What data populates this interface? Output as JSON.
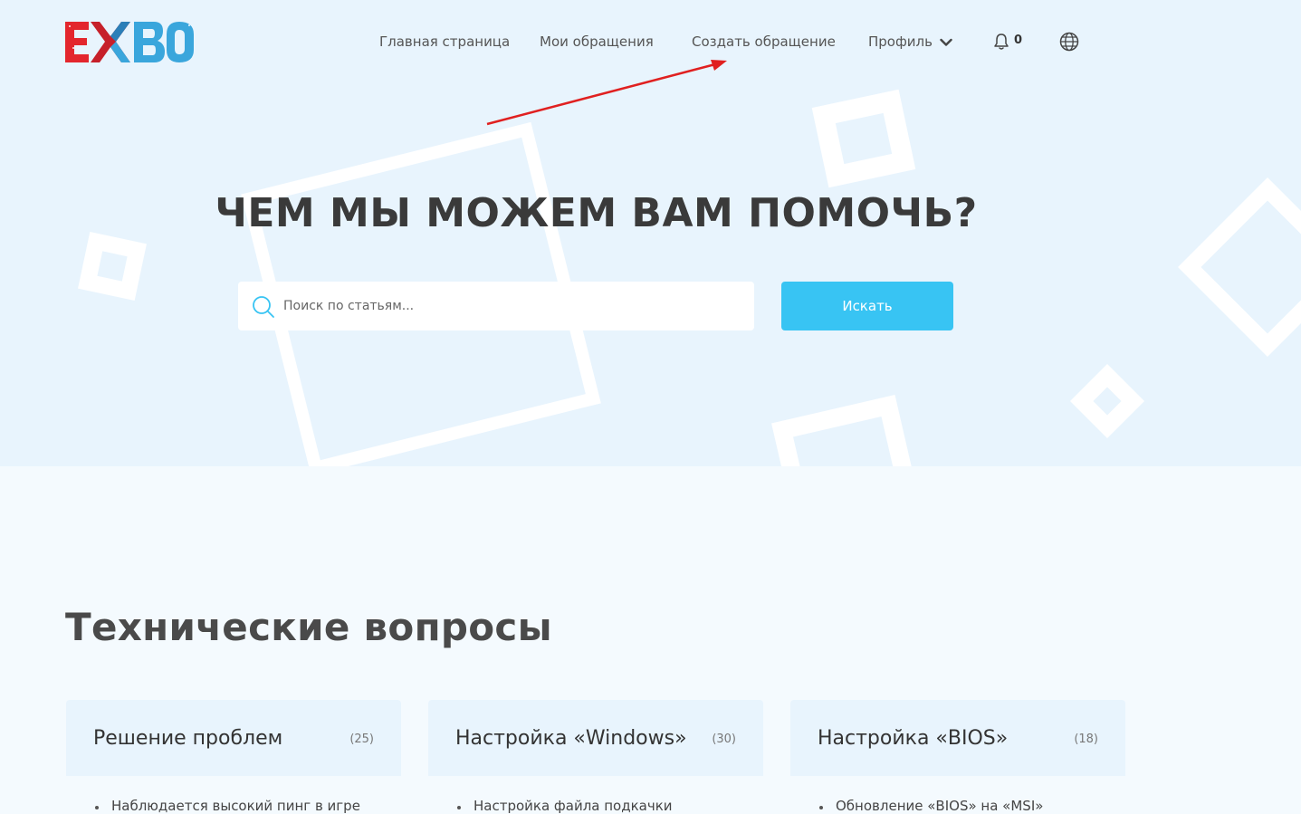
{
  "logo": {
    "text": "EXBO"
  },
  "nav": {
    "items": [
      {
        "label": "Главная страница"
      },
      {
        "label": "Мои обращения"
      },
      {
        "label": "Создать обращение"
      },
      {
        "label": "Профиль"
      }
    ],
    "notifications_count": "0"
  },
  "hero": {
    "title": "ЧЕМ МЫ МОЖЕМ ВАМ ПОМОЧЬ?",
    "search_placeholder": "Поиск по статьям...",
    "search_button": "Искать"
  },
  "section": {
    "title": "Технические вопросы",
    "cards": [
      {
        "title": "Решение проблем",
        "count": "(25)",
        "first_item": "Наблюдается высокий пинг в игре"
      },
      {
        "title": "Настройка «Windows»",
        "count": "(30)",
        "first_item": "Настройка файла подкачки"
      },
      {
        "title": "Настройка «BIOS»",
        "count": "(18)",
        "first_item": "Обновление «BIOS» на «MSI»"
      }
    ]
  },
  "colors": {
    "hero_bg": "#e8f4fd",
    "page_bg": "#f4fafe",
    "accent": "#38c4f3",
    "logo_red": "#e3262d",
    "logo_blue": "#3aa6dc",
    "annotation_arrow": "#e02020"
  },
  "icons": [
    "search-icon",
    "chevron-down-icon",
    "bell-icon",
    "globe-icon"
  ]
}
